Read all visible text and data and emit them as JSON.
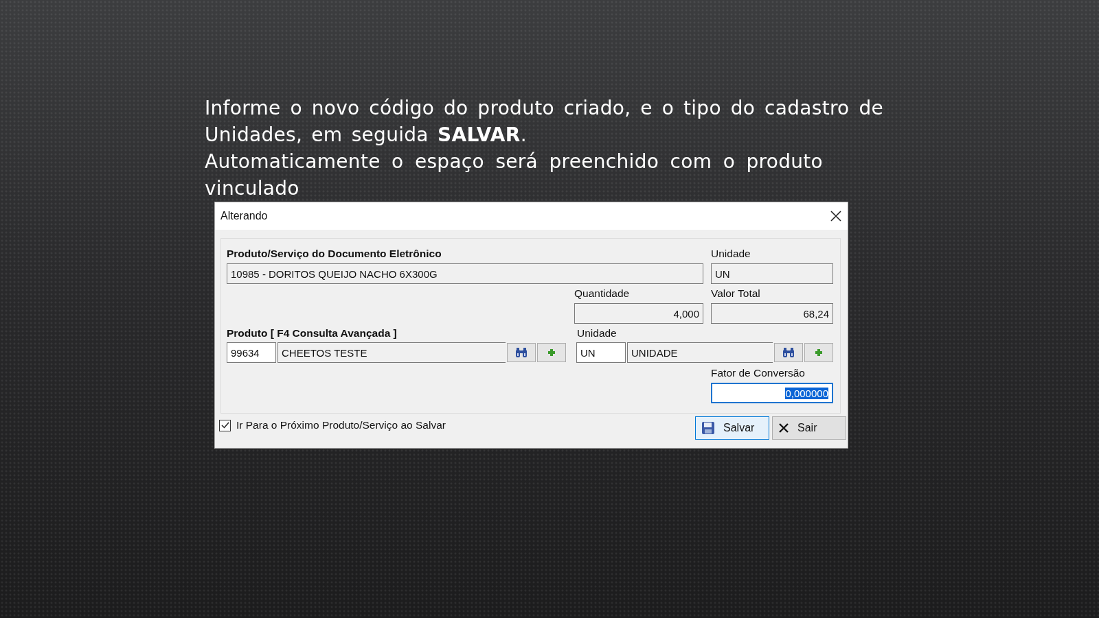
{
  "caption": [
    "Informe o novo código do produto criado, e o tipo do cadastro de Unidades, em seguida **SALVAR**.",
    "Automaticamente o espaço será preenchido com o produto vinculado"
  ],
  "dialog": {
    "title": "Alterando",
    "document_product": {
      "label": "Produto/Serviço do Documento Eletrônico",
      "value": "10985 - DORITOS QUEIJO NACHO 6X300G"
    },
    "document_unit": {
      "label": "Unidade",
      "value": "UN"
    },
    "quantity": {
      "label": "Quantidade",
      "value": "4,000"
    },
    "total_value": {
      "label": "Valor Total",
      "value": "68,24"
    },
    "product": {
      "label": "Produto [ F4 Consulta Avançada ]",
      "code": "99634",
      "name": "CHEETOS TESTE"
    },
    "unit": {
      "label": "Unidade",
      "code": "UN",
      "name": "UNIDADE"
    },
    "conversion_factor": {
      "label": "Fator de Conversão",
      "value": "0,000000",
      "focused": true,
      "selected": true
    },
    "next_on_save": {
      "label": "Ir Para o Próximo Produto/Serviço ao Salvar",
      "checked": true
    },
    "buttons": [
      {
        "kind": "save",
        "label": "Salvar",
        "selected": true
      },
      {
        "kind": "exit",
        "label": "Sair",
        "selected": false
      }
    ]
  }
}
